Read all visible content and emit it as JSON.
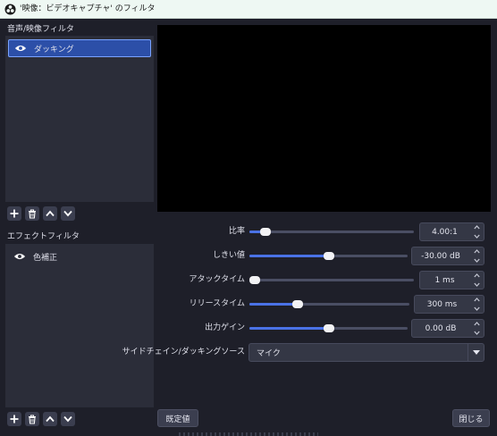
{
  "window": {
    "title": "'映像：ビデオキャプチャ' のフィルタ",
    "icon": "obs-logo-icon"
  },
  "audio_video_filters": {
    "label": "音声/映像フィルタ",
    "items": [
      {
        "label": "ダッキング",
        "visible_icon": "eye-icon",
        "selected": true
      }
    ]
  },
  "effect_filters": {
    "label": "エフェクトフィルタ",
    "items": [
      {
        "label": "色補正",
        "visible_icon": "eye-icon",
        "selected": false
      }
    ]
  },
  "toolbar_icons": [
    "plus-icon",
    "trash-icon",
    "chevron-up-icon",
    "chevron-down-icon"
  ],
  "settings": {
    "ratio": {
      "label": "比率",
      "value": "4.00:1",
      "level": 0.1
    },
    "threshold": {
      "label": "しきい値",
      "value": "-30.00 dB",
      "level": 0.5
    },
    "attack": {
      "label": "アタックタイム",
      "value": "1 ms",
      "level": 0.0
    },
    "release": {
      "label": "リリースタイム",
      "value": "300 ms",
      "level": 0.3
    },
    "output_gain": {
      "label": "出力ゲイン",
      "value": "0.00 dB",
      "level": 0.5
    },
    "sidechain": {
      "label": "サイドチェイン/ダッキングソース",
      "value": "マイク"
    }
  },
  "buttons": {
    "defaults": "既定値",
    "close": "閉じる"
  },
  "colors": {
    "accent": "#4a72e6",
    "selection": "#2c4fa8",
    "background": "#1e1f29",
    "panel": "#2b2d39"
  }
}
